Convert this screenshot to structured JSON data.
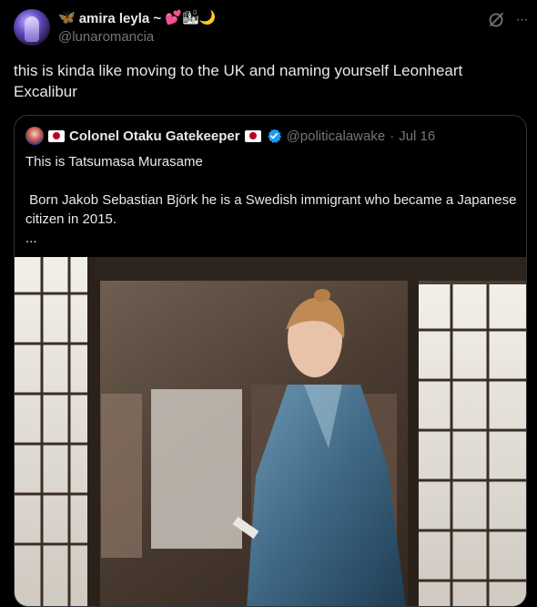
{
  "author": {
    "emoji_prefix": "🦋",
    "display_name": "amira leyla ~",
    "emoji_suffix": "💕🏙🌙",
    "handle": "@lunaromancia"
  },
  "tweet": {
    "text": "this is kinda like moving to the UK and naming yourself Leonheart Excalibur"
  },
  "quote": {
    "author_name": "Colonel Otaku Gatekeeper",
    "handle": "@politicalawake",
    "separator": "·",
    "date": "Jul 16",
    "text": "This is Tatsumasa Murasame\n\n Born Jakob Sebastian Björk he is a Swedish immigrant who became a Japanese citizen in 2015.\n..."
  },
  "icons": {
    "grok": "grok-icon",
    "more": "more-icon",
    "verified": "verified-badge-icon",
    "flag": "japan-flag-icon"
  },
  "colors": {
    "background": "#000000",
    "text": "#e7e9ea",
    "secondary": "#71767b",
    "border": "#2f3336",
    "verified": "#1d9bf0"
  }
}
